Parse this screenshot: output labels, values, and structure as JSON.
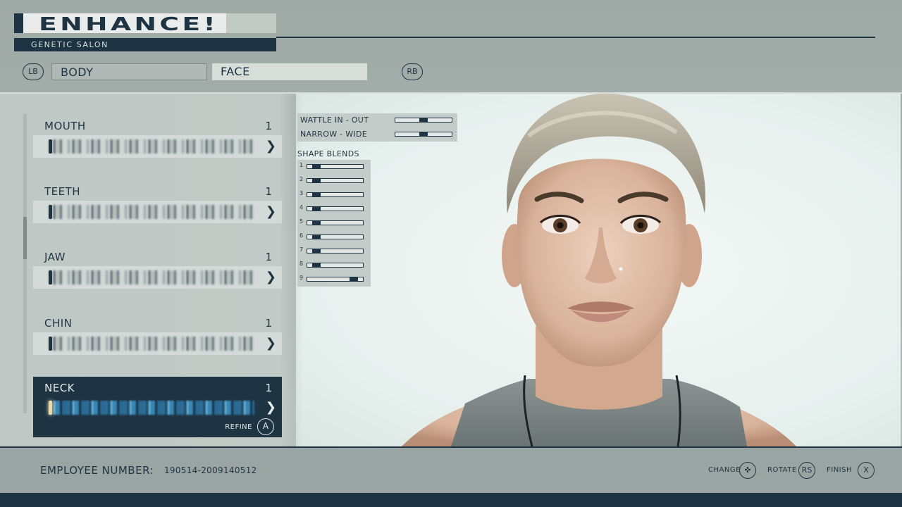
{
  "header": {
    "logo_text": "ENHANCE!",
    "subtitle": "GENETIC SALON"
  },
  "tabs": {
    "left_bumper": "LB",
    "right_bumper": "RB",
    "items": [
      {
        "label": "BODY",
        "active": false
      },
      {
        "label": "FACE",
        "active": true
      }
    ]
  },
  "features": {
    "items": [
      {
        "label": "MOUTH",
        "value": "1"
      },
      {
        "label": "TEETH",
        "value": "1"
      },
      {
        "label": "JAW",
        "value": "1"
      },
      {
        "label": "CHIN",
        "value": "1"
      },
      {
        "label": "NECK",
        "value": "1",
        "selected": true
      }
    ],
    "refine_label": "REFINE",
    "refine_button": "A"
  },
  "sliders": [
    {
      "label": "WATTLE IN - OUT",
      "value": 0.5
    },
    {
      "label": "NARROW - WIDE",
      "value": 0.5
    }
  ],
  "shape_blends": {
    "title": "SHAPE BLENDS",
    "items": [
      {
        "label": "1",
        "value": 0.1
      },
      {
        "label": "2",
        "value": 0.1
      },
      {
        "label": "3",
        "value": 0.1
      },
      {
        "label": "4",
        "value": 0.1
      },
      {
        "label": "5",
        "value": 0.1
      },
      {
        "label": "6",
        "value": 0.1
      },
      {
        "label": "7",
        "value": 0.1
      },
      {
        "label": "8",
        "value": 0.1
      },
      {
        "label": "9",
        "value": 0.9
      }
    ]
  },
  "footer": {
    "employee_label": "EMPLOYEE NUMBER:",
    "employee_number": "190514-2009140512",
    "hints": [
      {
        "label": "CHANGE",
        "button": "✜"
      },
      {
        "label": "ROTATE",
        "button": "RS"
      },
      {
        "label": "FINISH",
        "button": "X"
      }
    ]
  },
  "colors": {
    "accent_dark": "#1f3443",
    "panel": "#c2cac7",
    "viewport_bg": "#e6f0ed"
  }
}
